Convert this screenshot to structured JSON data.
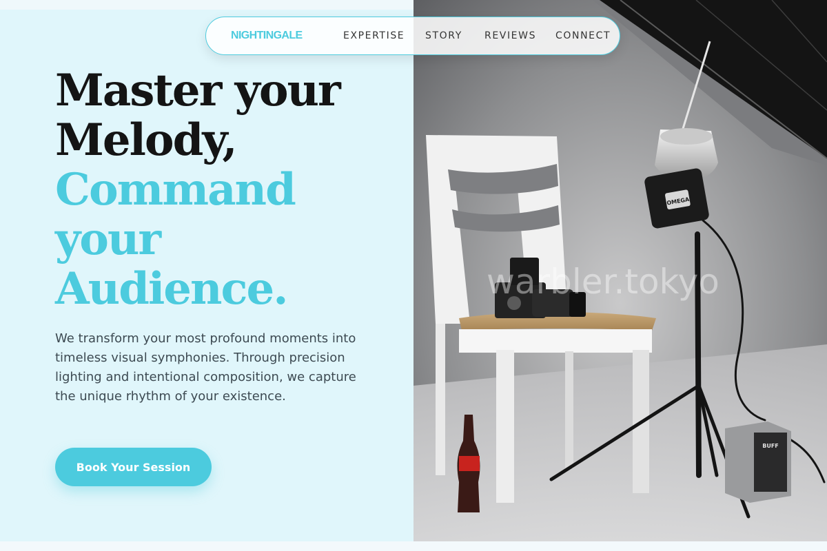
{
  "nav": {
    "brand": "NIGHTINGALE",
    "links": [
      "EXPERTISE",
      "STORY",
      "REVIEWS",
      "CONNECT"
    ]
  },
  "hero": {
    "title_lines": [
      "Master your",
      "Melody,"
    ],
    "accent_lines": [
      "Command",
      "your",
      "Audience."
    ],
    "body": "We transform your most profound moments into timeless visual symphonies. Through precision lighting and intentional composition, we capture the unique rhythm of your existence.",
    "cta_label": "Book Your Session"
  },
  "photo": {
    "watermark": "warbler.tokyo",
    "strobe_label": "OMEGA",
    "power_pack_label": "BUFF"
  },
  "colors": {
    "accent": "#4ccbde",
    "heading": "#141414",
    "body_text": "#3d4a52",
    "panel_bg": "#e0f6fb"
  }
}
